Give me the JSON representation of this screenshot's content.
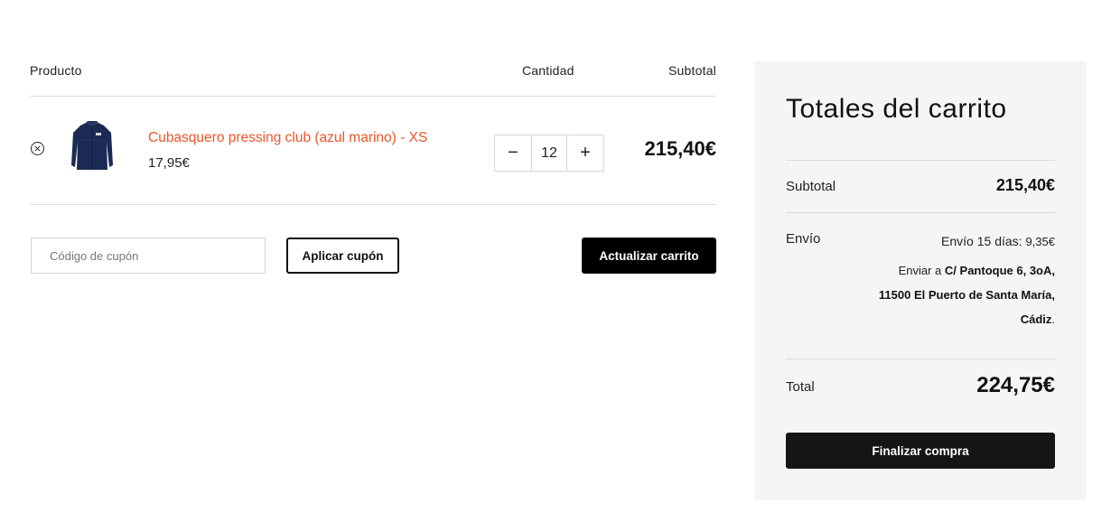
{
  "cart": {
    "headers": {
      "product": "Producto",
      "quantity": "Cantidad",
      "subtotal": "Subtotal"
    },
    "item": {
      "name": "Cubasquero pressing club (azul marino) - XS",
      "price": "17,95€",
      "quantity": "12",
      "subtotal": "215,40€",
      "image": "navy-jacket"
    },
    "qty_minus": "−",
    "qty_plus": "+",
    "coupon_placeholder": "Código de cupón",
    "apply_coupon": "Aplicar cupón",
    "update_cart": "Actualizar carrito"
  },
  "totals": {
    "title": "Totales del carrito",
    "subtotal_label": "Subtotal",
    "subtotal_value": "215,40€",
    "shipping_label": "Envío",
    "shipping_option": "Envío 15 días:",
    "shipping_amount": "9,35€",
    "ship_to_prefix": "Enviar a",
    "ship_to_street": "C/ Pantoque 6, 3oA,",
    "ship_to_city": "11500 El Puerto de Santa María,",
    "ship_to_province": "Cádiz",
    "ship_to_suffix": ".",
    "total_label": "Total",
    "total_value": "224,75€",
    "checkout": "Finalizar compra"
  },
  "colors": {
    "accent": "#e8562a",
    "button_dark": "#000000",
    "panel_bg": "#f5f5f5"
  }
}
